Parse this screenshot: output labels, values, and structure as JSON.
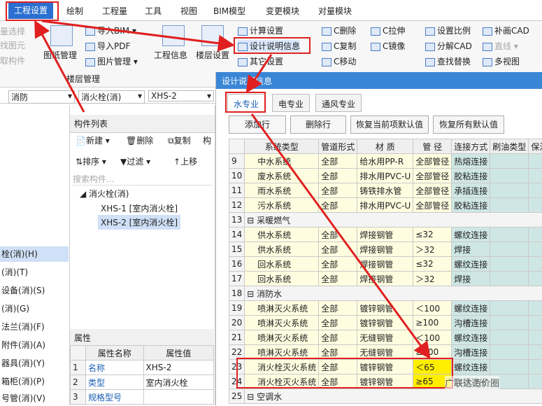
{
  "menu": [
    "工程设置",
    "绘制",
    "工程量",
    "工具",
    "视图",
    "BIM模型",
    "变更模块",
    "对量模块"
  ],
  "ribbon": {
    "left_partial": [
      "量选择",
      "找图元",
      "取构件"
    ],
    "drawing_manage": "图纸管理",
    "import_bim": "导入BIM",
    "import_pdf": "导入PDF",
    "image_manage": "图片管理",
    "group_label": "楼层管理",
    "project_info": "工程信息",
    "floor_settings": "楼层设置",
    "calc_settings": "计算设置",
    "design_info": "设计说明信息",
    "other_settings": "其它设置",
    "c_delete": "C删除",
    "c_copy": "C复制",
    "c_move": "C移动",
    "c_stretch": "C拉伸",
    "c_mirror": "C镜像",
    "set_scale": "设置比例",
    "split_cad": "分解CAD",
    "find_replace": "查找替换",
    "patch_cad": "补画CAD",
    "straight": "直线",
    "multiview": "多视图"
  },
  "filters": {
    "prof": "消防",
    "type": "消火栓(消)",
    "code": "XHS-2"
  },
  "tree": [
    "栓(消)(H)",
    "(消)(T)",
    "设备(消)(S)",
    "(消)(G)",
    "法兰(消)(F)",
    "附件(消)(A)",
    "器具(消)(Y)",
    "箱柜(消)(P)",
    "号管(消)(V)"
  ],
  "components": {
    "title": "构件列表",
    "new": "新建",
    "del": "删除",
    "copy": "复制",
    "more": "构",
    "sort": "排序",
    "filter": "过滤",
    "up": "上移",
    "search_placeholder": "搜索构件...",
    "group": "消火栓(消)",
    "items": [
      "XHS-1 [室内消火栓]",
      "XHS-2 [室内消火栓]"
    ]
  },
  "props": {
    "title": "属性",
    "h_name": "属性名称",
    "h_value": "属性值",
    "rows": [
      [
        "1",
        "名称",
        "XHS-2"
      ],
      [
        "2",
        "类型",
        "室内消火栓"
      ],
      [
        "3",
        "规格型号",
        ""
      ]
    ]
  },
  "dialog": {
    "title": "设计说明信息",
    "tabs": [
      "水专业",
      "电专业",
      "通风专业"
    ],
    "buttons": [
      "添加行",
      "删除行",
      "恢复当前项默认值",
      "恢复所有默认值"
    ],
    "headers": [
      "系统类型",
      "管道形式",
      "材 质",
      "管 径",
      "连接方式",
      "刷油类型",
      "保温材"
    ],
    "rows": [
      [
        "9",
        "中水系统",
        "全部",
        "给水用PP-R",
        "全部管径",
        "热熔连接"
      ],
      [
        "10",
        "废水系统",
        "全部",
        "排水用PVC-U",
        "全部管径",
        "胶粘连接"
      ],
      [
        "11",
        "雨水系统",
        "全部",
        "铸铁排水管",
        "全部管径",
        "承插连接"
      ],
      [
        "12",
        "污水系统",
        "全部",
        "排水用PVC-U",
        "全部管径",
        "胶粘连接"
      ],
      [
        "13",
        "采暖燃气",
        "",
        "",
        "",
        ""
      ],
      [
        "14",
        "供水系统",
        "全部",
        "焊接钢管",
        "≤32",
        "螺纹连接"
      ],
      [
        "15",
        "供水系统",
        "全部",
        "焊接钢管",
        "＞32",
        "焊接"
      ],
      [
        "16",
        "回水系统",
        "全部",
        "焊接钢管",
        "≤32",
        "螺纹连接"
      ],
      [
        "17",
        "回水系统",
        "全部",
        "焊接钢管",
        "＞32",
        "焊接"
      ],
      [
        "18",
        "消防水",
        "",
        "",
        "",
        ""
      ],
      [
        "19",
        "喷淋灭火系统",
        "全部",
        "镀锌钢管",
        "＜100",
        "螺纹连接"
      ],
      [
        "20",
        "喷淋灭火系统",
        "全部",
        "镀锌钢管",
        "≥100",
        "沟槽连接"
      ],
      [
        "21",
        "喷淋灭火系统",
        "全部",
        "无缝钢管",
        "＜100",
        "螺纹连接"
      ],
      [
        "22",
        "喷淋灭火系统",
        "全部",
        "无缝钢管",
        "≥100",
        "沟槽连接"
      ],
      [
        "23",
        "消火栓灭火系统",
        "全部",
        "镀锌钢管",
        "＜65",
        "螺纹连接"
      ],
      [
        "24",
        "消火栓灭火系统",
        "全部",
        "镀锌钢管",
        "≥65",
        "沟槽连接"
      ],
      [
        "25",
        "空调水",
        "",
        "",
        "",
        ""
      ]
    ]
  },
  "watermark": "广联达造价圈"
}
